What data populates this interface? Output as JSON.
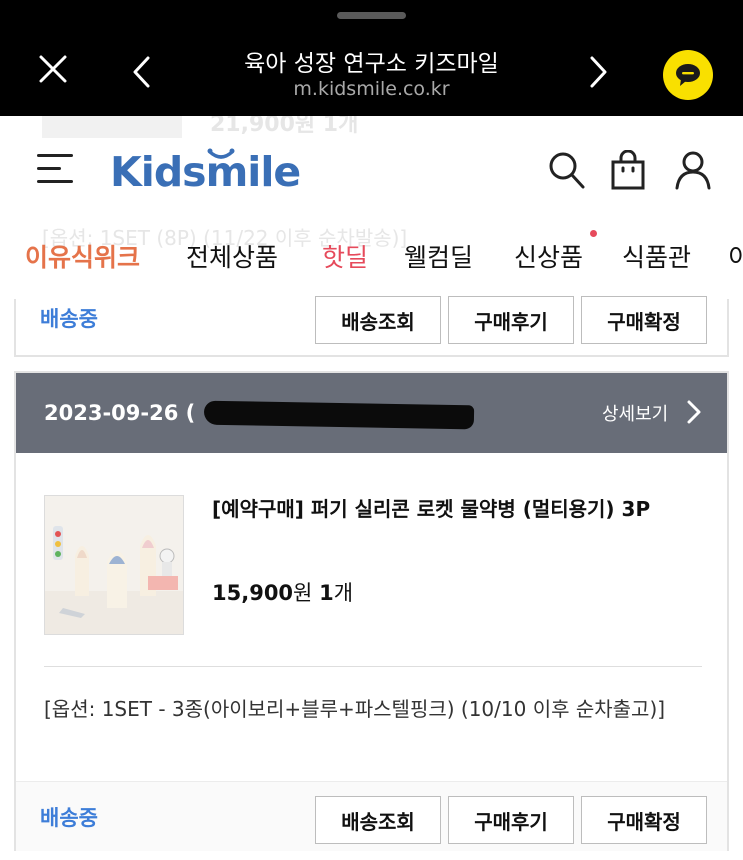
{
  "browser": {
    "title": "육아 성장 연구소 키즈마일",
    "url": "m.kidsmile.co.kr"
  },
  "background_ghost": {
    "price": "21,900원 1개",
    "option": "[옵션: 1SET (8P) (11/22 이후 순차발송)]"
  },
  "header": {
    "logo_text": "Kidsmile",
    "nav": [
      "이유식위크",
      "전체상품",
      "핫딜",
      "웰컴딜",
      "신상품",
      "식품관",
      "이"
    ]
  },
  "previous_order": {
    "status": "배송중",
    "buttons": [
      "배송조회",
      "구매후기",
      "구매확정"
    ]
  },
  "order": {
    "date": "2023-09-26",
    "date_suffix": "(",
    "detail_label": "상세보기",
    "product_name": "[예약구매] 퍼기 실리콘 로켓 물약병 (멀티용기) 3P",
    "price": "15,900",
    "price_unit": "원",
    "quantity": "1",
    "quantity_unit": "개",
    "option": "[옵션: 1SET - 3종(아이보리+블루+파스텔핑크) (10/10 이후 순차출고)]",
    "status": "배송중",
    "buttons": [
      "배송조회",
      "구매후기",
      "구매확정"
    ]
  },
  "colors": {
    "logo": "#3a6fb6",
    "nav_active": "#e5734a",
    "nav_hot": "#e64a5b",
    "status": "#3d7dd8",
    "order_header": "#686d78",
    "kakao": "#f9e000"
  }
}
